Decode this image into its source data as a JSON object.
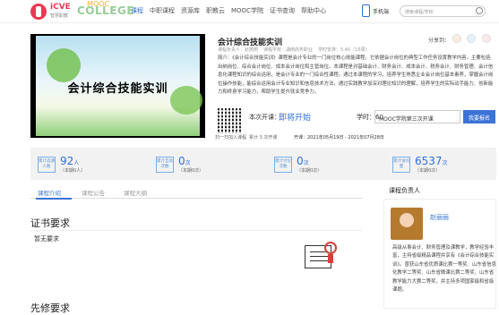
{
  "header": {
    "logo_brand": "iCVE",
    "logo_sub": "智慧职教",
    "logo_college": "COLLEGE",
    "logo_mooc": "MOOC",
    "nav": [
      "课程",
      "中职课程",
      "资源库",
      "职教云",
      "MOOC学院",
      "证书查询",
      "帮助中心"
    ],
    "phone_label": "手机端",
    "search_placeholder": "搜索课程/学校"
  },
  "course": {
    "cover_title": "会计综合技能实训",
    "title": "会计综合技能实训",
    "meta": [
      "课程负责人：赵丽丽",
      "课程学校：湖南商务职业",
      "学时安排：5.40（16周）"
    ],
    "share_label": "分享到：",
    "intro_label": "简介：",
    "intro": "《会计综合技能实训》课程是会计专业的一门岗位核心技能课程。它依据会计岗位的典型工作任务设置教学内容，主要包括出纳岗位、综合会计岗位、成本会计岗位和主管岗位。本课程是对基础会计、财务会计、成本会计、税务会计、财务管理、会计信息化课程知识的综合运用，是会计专业的一门综合性课程。通过本课程的学习，培养学生熟悉企业会计岗位基本素养，掌握会计岗位操作技能，能综合运用会计专业知识和信息技术方法，通过实践教学加深对理论知识的理解，培养学生的实际动手能力、创新能力和终身学习能力，帮助学生提升就业竞争力。",
    "qr_caption": "扫一扫加入课程",
    "open_label": "本次开课：",
    "open_value": "即将开始",
    "credit_label": "学时：",
    "credit_value": "60",
    "select_value": "MOOC学院第三次开课",
    "join_button": "我要报名",
    "enroll_count": "累计 3 次开课",
    "dates": "开课：2021年05月19日 - 2021年07月28日"
  },
  "stats": [
    {
      "label": "累计选课人数",
      "value": "92",
      "unit": "人",
      "sub": "（本期0人）"
    },
    {
      "label": "累计互动次数",
      "value": "0",
      "unit": "次",
      "sub": "（本期0次）"
    },
    {
      "label": "累计讨论次数",
      "value": "0",
      "unit": "次",
      "sub": "（本期0次）"
    },
    {
      "label": "累计访问量",
      "value": "6537",
      "unit": "次",
      "sub": "（本期0次）"
    }
  ],
  "tabs": [
    "课程介绍",
    "课程公告",
    "课程大纲"
  ],
  "sections": {
    "cert_title": "证书要求",
    "cert_content": "暂无要求",
    "next_title": "先修要求"
  },
  "teacher": {
    "heading": "课程负责人",
    "name": "赵丽丽",
    "desc": "高级从事会计、财务管理及课教学，教学经验丰富，主持省级精品课程并享有《会计综合技能实训》。曾获山东省优质课比赛一等奖、山东省信息化教学二等奖、山东省微课比赛二等奖、山东省教学能力大赛二等奖，并主持多项国家级和省级课题。"
  }
}
